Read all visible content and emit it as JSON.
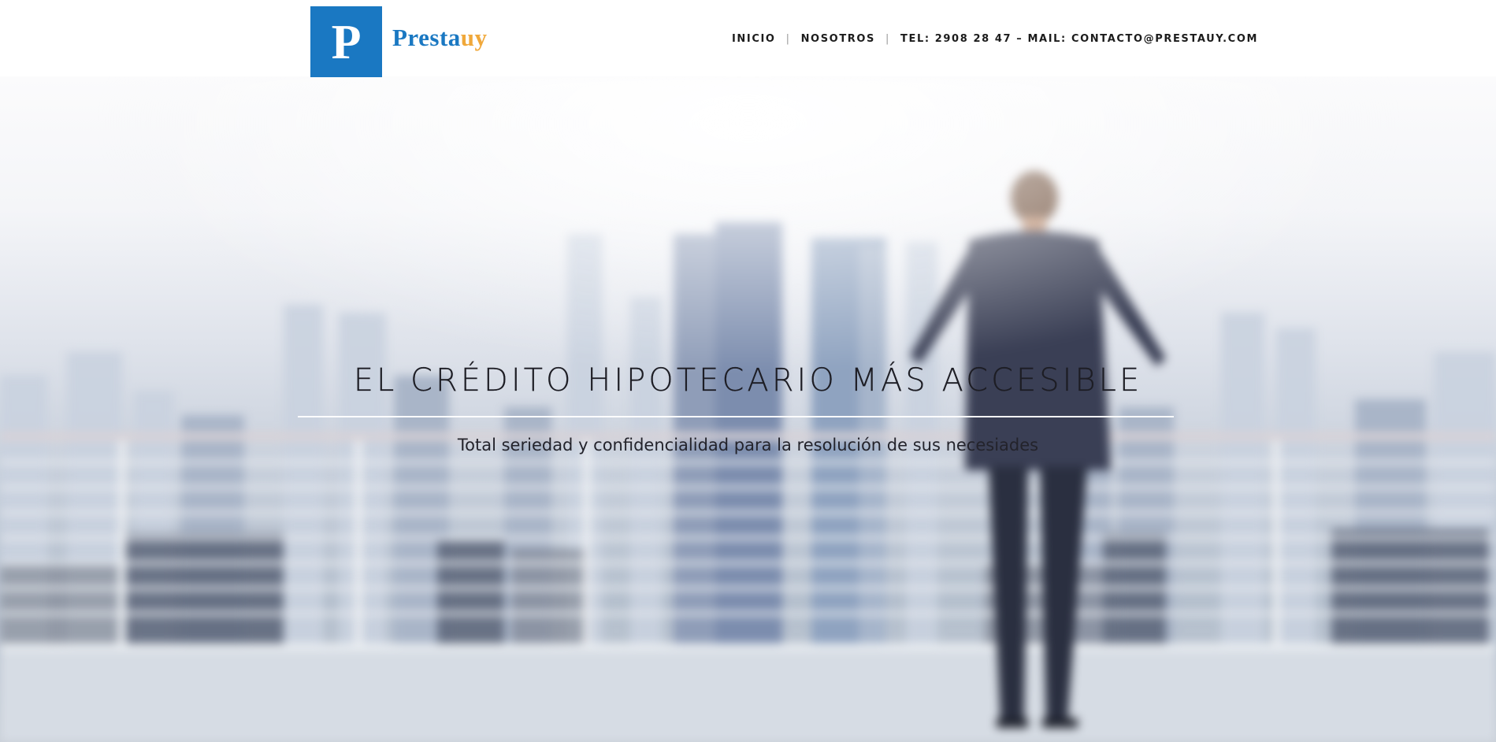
{
  "header": {
    "logo": {
      "mark_letter": "P",
      "word_part1": "Presta",
      "word_part2": "uy"
    },
    "nav": {
      "items": [
        {
          "label": "INICIO"
        },
        {
          "label": "NOSOTROS"
        },
        {
          "label": "TEL: 2908 28 47 – MAIL: CONTACTO@PRESTAUY.COM"
        }
      ],
      "separator": "|"
    }
  },
  "hero": {
    "title": "EL CRÉDITO HIPOTECARIO MÁS ACCESIBLE",
    "subtitle": "Total seriedad y confidencialidad para la resolución de sus necesiades"
  },
  "colors": {
    "brand_blue": "#1a78c2",
    "brand_orange": "#f0a83a",
    "nav_text": "#1c1c1c"
  }
}
